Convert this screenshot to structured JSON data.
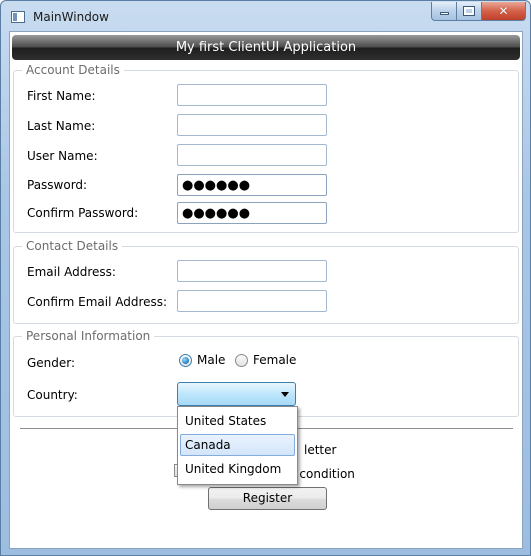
{
  "window": {
    "title": "MainWindow",
    "controls": {
      "minimize": "minimize-icon",
      "maximize": "maximize-icon",
      "close": "close-icon"
    }
  },
  "header": {
    "title": "My first ClientUI Application"
  },
  "account": {
    "legend": "Account Details",
    "first_name_label": "First Name:",
    "first_name_value": "",
    "last_name_label": "Last Name:",
    "last_name_value": "",
    "user_name_label": "User Name:",
    "user_name_value": "",
    "password_label": "Password:",
    "password_value": "●●●●●●",
    "confirm_password_label": "Confirm Password:",
    "confirm_password_value": "●●●●●●"
  },
  "contact": {
    "legend": "Contact Details",
    "email_label": "Email Address:",
    "email_value": "",
    "confirm_email_label": "Confirm Email Address:",
    "confirm_email_value": ""
  },
  "personal": {
    "legend": "Personal Information",
    "gender_label": "Gender:",
    "gender_options": [
      "Male",
      "Female"
    ],
    "gender_selected": "Male",
    "country_label": "Country:",
    "country_value": "",
    "country_options": [
      "United States",
      "Canada",
      "United Kingdom"
    ],
    "country_highlighted": "Canada"
  },
  "footer": {
    "newsletter_partial": "letter",
    "terms_partial": "d condition",
    "register_label": "Register"
  },
  "colors": {
    "accent": "#3c7fb1",
    "header_bar": "#2f2f2f",
    "dropdown_highlight": "#d3e5fb"
  }
}
